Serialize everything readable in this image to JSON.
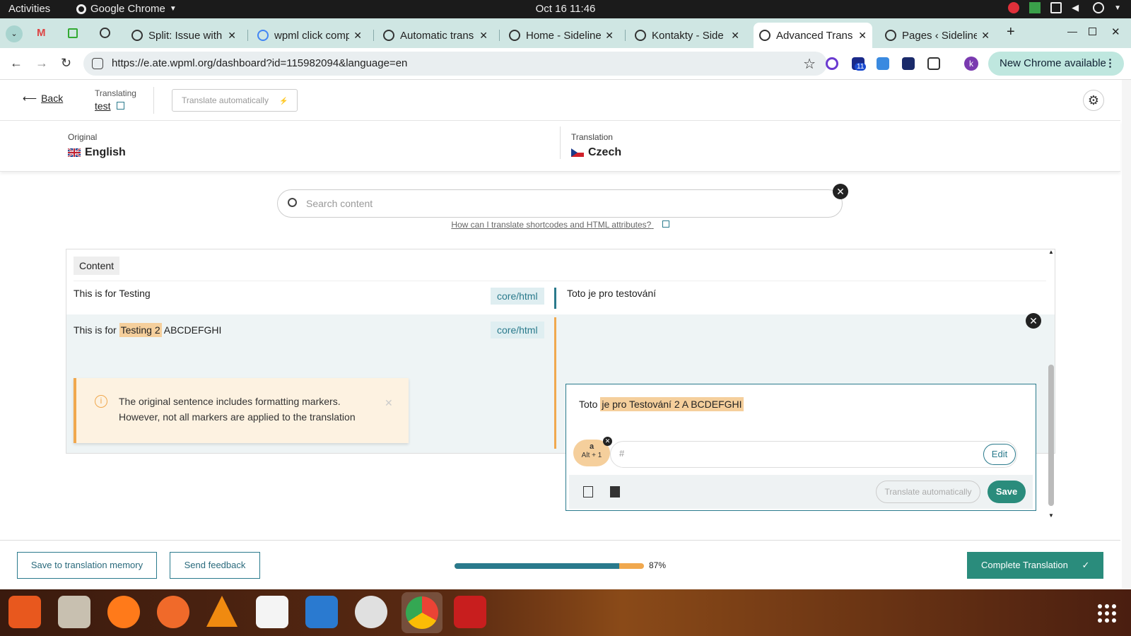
{
  "system": {
    "activities": "Activities",
    "app_name": "Google Chrome",
    "clock": "Oct 16  11:46"
  },
  "browser": {
    "tabs": [
      {
        "title": "Split: Issue with"
      },
      {
        "title": "wpml click comp"
      },
      {
        "title": "Automatic trans"
      },
      {
        "title": "Home - Sideline"
      },
      {
        "title": "Kontakty - Side"
      },
      {
        "title": "Advanced Trans",
        "active": true
      },
      {
        "title": "Pages ‹ Sideline"
      }
    ],
    "url": "https://e.ate.wpml.org/dashboard?id=115982094&language=en",
    "new_chrome": "New Chrome available",
    "ext_badge": "11",
    "profile_initial": "k"
  },
  "header": {
    "back": "Back",
    "translating_label": "Translating",
    "translating_name": "test",
    "translate_auto": "Translate automatically",
    "translate_auto_icon": "⚡"
  },
  "languages": {
    "original_label": "Original",
    "original_lang": "English",
    "translation_label": "Translation",
    "translation_lang": "Czech"
  },
  "search": {
    "placeholder": "Search content",
    "help_link": "How can I translate shortcodes and HTML attributes?"
  },
  "content": {
    "tag": "Content",
    "rows": [
      {
        "source": "This is for Testing",
        "type": "core/html",
        "target": "Toto je pro testování"
      },
      {
        "source_pre": "This is for ",
        "source_hl": "Testing 2",
        "source_post": " ABCDEFGHI",
        "type": "core/html",
        "target_pre": "Toto ",
        "target_hl": "je pro Testování 2 A BCDEFGHI"
      }
    ],
    "warning_line1": "The original sentence includes formatting markers.",
    "warning_line2": "However, not all markers are applied to the translation",
    "marker_letter": "a",
    "marker_shortcut": "Alt + 1",
    "marker_hash": "#",
    "edit": "Edit",
    "translate_auto": "Translate automatically",
    "save": "Save"
  },
  "footer": {
    "save_memory": "Save to translation memory",
    "send_feedback": "Send feedback",
    "progress": 0.87,
    "progress_label": "87%",
    "complete": "Complete Translation",
    "complete_icon": "✓"
  },
  "colors": {
    "accent": "#2a8c7c",
    "highlight": "#f5cf9c",
    "warning": "#f0a84e",
    "tab_bar": "#cfe6e3"
  }
}
